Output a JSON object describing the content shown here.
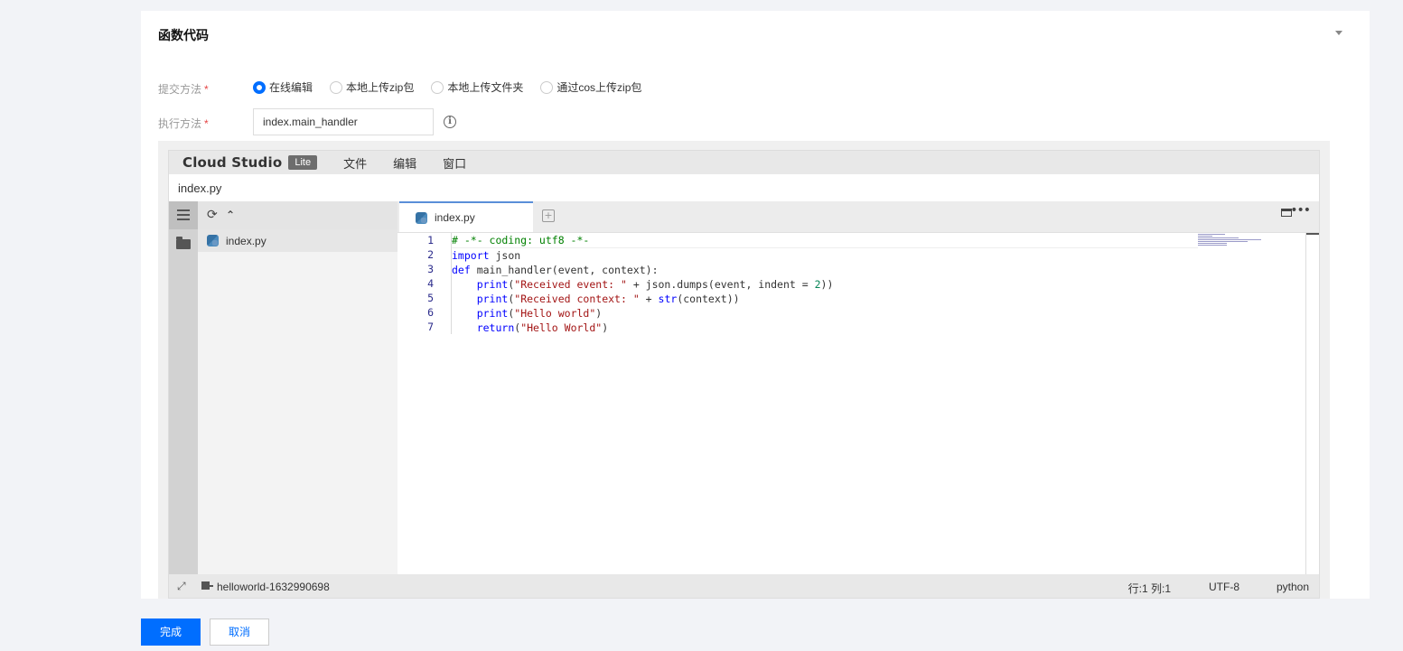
{
  "section": {
    "title": "函数代码"
  },
  "form": {
    "submit_method": {
      "label": "提交方法",
      "required_mark": "*",
      "options": [
        "在线编辑",
        "本地上传zip包",
        "本地上传文件夹",
        "通过cos上传zip包"
      ],
      "selected": "在线编辑"
    },
    "handler": {
      "label": "执行方法",
      "required_mark": "*",
      "value": "index.main_handler"
    }
  },
  "ide": {
    "brand": "Cloud Studio",
    "badge": "Lite",
    "menus": [
      "文件",
      "编辑",
      "窗口"
    ],
    "path": "index.py",
    "explorer": {
      "files": [
        "index.py"
      ]
    },
    "tab": {
      "label": "index.py"
    },
    "line_numbers": [
      "1",
      "2",
      "3",
      "4",
      "5",
      "6",
      "7"
    ],
    "code_lines": [
      "# -*- coding: utf8 -*-",
      "import json",
      "def main_handler(event, context):",
      "    print(\"Received event: \" + json.dumps(event, indent = 2))",
      "    print(\"Received context: \" + str(context))",
      "    print(\"Hello world\")",
      "    return(\"Hello World\")"
    ],
    "status": {
      "project": "helloworld-1632990698",
      "position": "行:1 列:1",
      "encoding": "UTF-8",
      "language": "python"
    }
  },
  "actions": {
    "confirm": "完成",
    "cancel": "取消"
  },
  "colors": {
    "primary": "#006eff",
    "required": "#e54545"
  }
}
